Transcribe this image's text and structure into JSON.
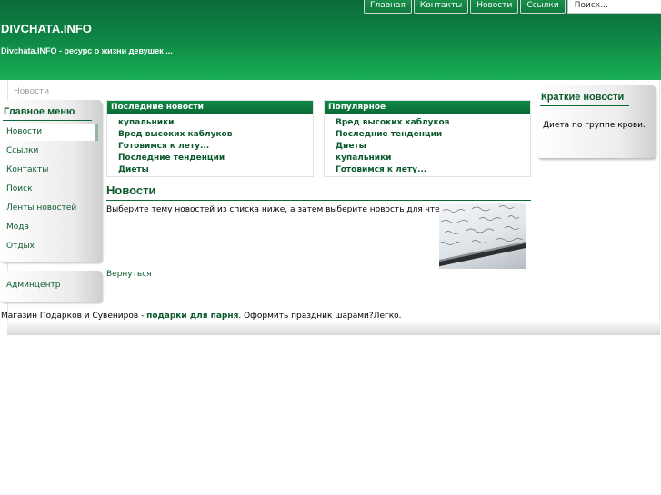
{
  "header": {
    "title": "DIVCHATA.INFO",
    "slogan": "Divchata.INFO - ресурс о жизни девушек ..."
  },
  "topnav": {
    "items": [
      "Главная",
      "Контакты",
      "Новости",
      "Ссылки"
    ],
    "search_placeholder": "Поиск..."
  },
  "breadcrumb": "Новости",
  "main_menu": {
    "title": "Главное меню",
    "items": [
      "Новости",
      "Ссылки",
      "Контакты",
      "Поиск",
      "Ленты новостей",
      "Мода",
      "Отдых"
    ],
    "active": "Новости",
    "admin_item": "Админцентр"
  },
  "latest_news": {
    "title": "Последние новости",
    "items": [
      "купальники",
      "Вред высоких каблуков",
      "Готовимся к лету...",
      "Последние тенденции",
      "Диеты"
    ]
  },
  "popular": {
    "title": "Популярное",
    "items": [
      "Вред высоких каблуков",
      "Последние тенденции",
      "Диеты",
      "купальники",
      "Готовимся к лету..."
    ]
  },
  "content": {
    "title": "Новости",
    "text": "Выберите тему новостей из списка ниже, а затем выберите новость для чтения.",
    "back_link": "Вернуться"
  },
  "brief_news": {
    "title": "Краткие новости",
    "text": "Диета по группе крови."
  },
  "footer": {
    "prefix": "Магазин Подарков и Сувениров - ",
    "link": "подарки для парня",
    "suffix": ". Оформить праздник шарами?Легко."
  },
  "colors": {
    "brand_green": "#0b6b38",
    "link_green": "#0b5a2e"
  }
}
